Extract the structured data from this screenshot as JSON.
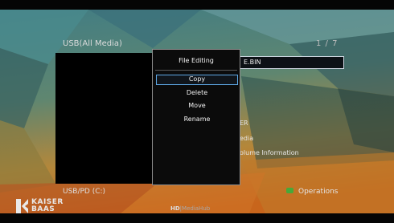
{
  "header": {
    "source_title": "USB(All Media)",
    "page_counter": "1 / 7"
  },
  "file_list": {
    "selected_file": "E.BIN",
    "items": [
      "ER",
      "edia",
      "olume Information"
    ]
  },
  "popup": {
    "title": "File Editing",
    "items": [
      "Copy",
      "Delete",
      "Move",
      "Rename"
    ],
    "selected_index": 0
  },
  "footer": {
    "device_label": "USB/PD (C:)",
    "operations_label": "Operations",
    "operations_button_color": "#47a83a"
  },
  "branding": {
    "logo_line1": "KAISER",
    "logo_line2": "BAAS",
    "product_bold": "HD",
    "product_thin": "|MediaHub"
  },
  "colors": {
    "selection_border": "#5ea8e6",
    "background_top": "#3b7a83",
    "background_bottom": "#c9821e"
  }
}
